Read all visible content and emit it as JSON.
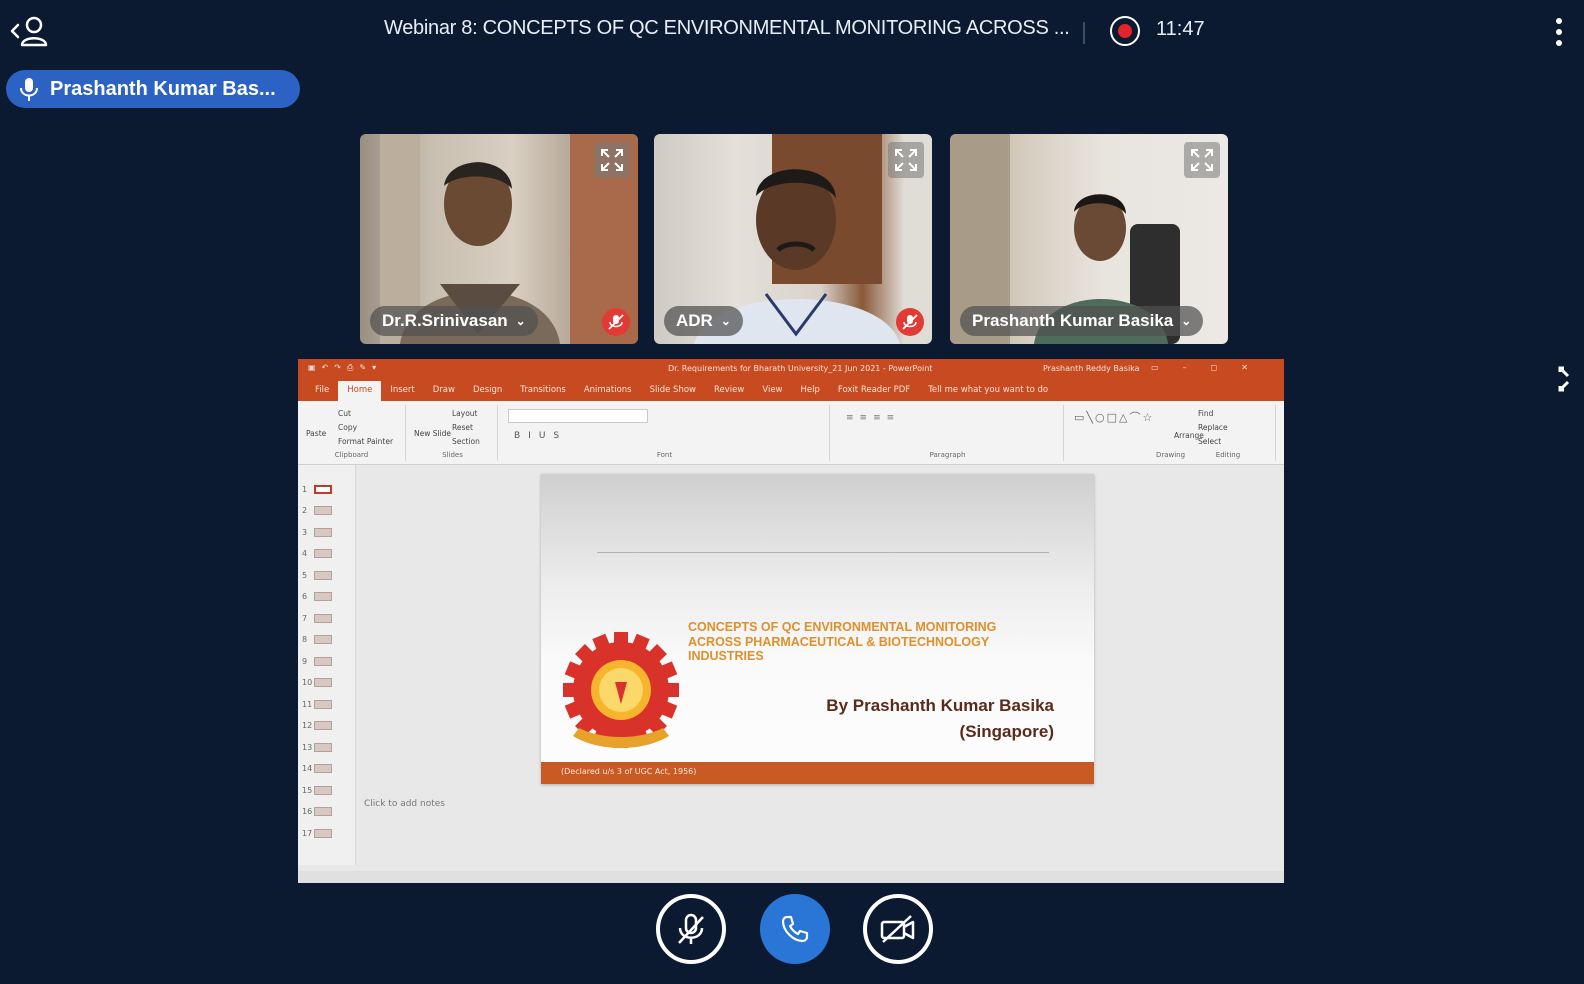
{
  "header": {
    "title": "Webinar 8: CONCEPTS OF QC ENVIRONMENTAL MONITORING ACROSS ...",
    "time": "11:47"
  },
  "active_speaker": {
    "name": "Prashanth Kumar Bas..."
  },
  "participants": [
    {
      "name": "Dr.R.Srinivasan",
      "muted": true
    },
    {
      "name": "ADR",
      "muted": true
    },
    {
      "name": "Prashanth Kumar Basika",
      "muted": false
    }
  ],
  "shared_screen": {
    "app_title": "Dr. Requirements for Bharath University_21 Jun 2021 - PowerPoint",
    "user": "Prashanth Reddy Basika",
    "menu_tabs": [
      "File",
      "Home",
      "Insert",
      "Draw",
      "Design",
      "Transitions",
      "Animations",
      "Slide Show",
      "Review",
      "View",
      "Help",
      "Foxit Reader PDF",
      "Tell me what you want to do"
    ],
    "active_tab": "Home",
    "ribbon_groups": [
      "Clipboard",
      "Slides",
      "Font",
      "Paragraph",
      "Drawing",
      "Editing"
    ],
    "ribbon_items": {
      "paste": "Paste",
      "cut": "Cut",
      "copy": "Copy",
      "format_painter": "Format Painter",
      "new_slide": "New Slide",
      "layout": "Layout",
      "reset": "Reset",
      "section": "Section",
      "arrange": "Arrange",
      "find": "Find",
      "replace": "Replace",
      "select": "Select"
    },
    "slide_numbers": [
      "1",
      "2",
      "3",
      "4",
      "5",
      "6",
      "7",
      "8",
      "9",
      "10",
      "11",
      "12",
      "13",
      "14",
      "15",
      "16",
      "17"
    ],
    "selected_slide": 1,
    "slide": {
      "heading": "CONCEPTS OF QC ENVIRONMENTAL MONITORING ACROSS PHARMACEUTICAL & BIOTECHNOLOGY INDUSTRIES",
      "byline": "By Prashanth Kumar Basika",
      "location": "(Singapore)",
      "footer": "(Declared u/s 3 of UGC Act, 1956)",
      "logo_text": "TO THE STARS BY HARD WORK"
    },
    "notes_placeholder": "Click to add notes"
  },
  "colors": {
    "background": "#0b1a31",
    "speaker_pill": "#2c62c4",
    "call_button": "#2a76d6",
    "record": "#e3242b",
    "ppt_accent": "#c74a20"
  },
  "icons": [
    "participants-icon",
    "record-icon",
    "more-icon",
    "microphone-icon",
    "expand-icon",
    "muted-mic-icon",
    "fullscreen-icon",
    "mic-off-icon",
    "phone-icon",
    "camera-off-icon"
  ]
}
